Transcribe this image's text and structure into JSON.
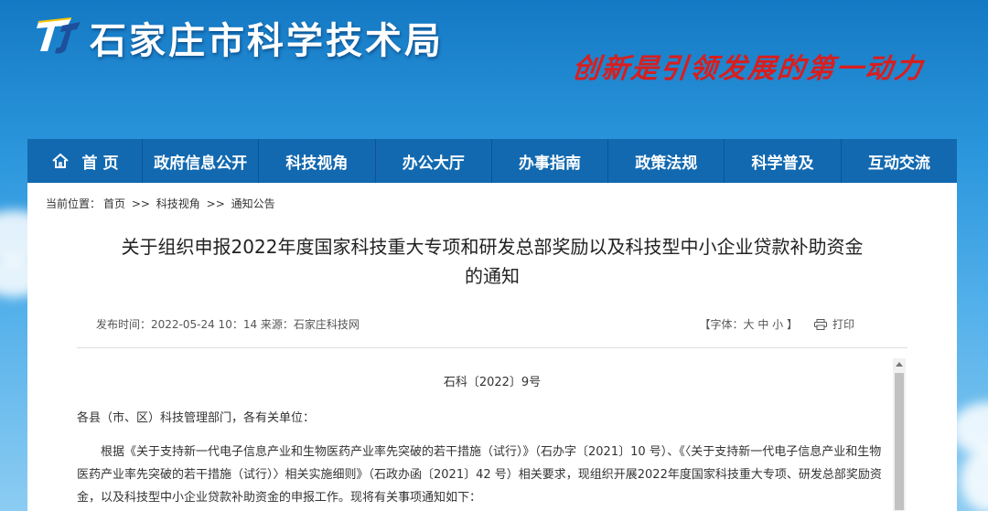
{
  "site": {
    "title": "石家庄市科学技术局",
    "slogan": "创新是引领发展的第一动力"
  },
  "nav": {
    "items": [
      {
        "label": "首 页"
      },
      {
        "label": "政府信息公开"
      },
      {
        "label": "科技视角"
      },
      {
        "label": "办公大厅"
      },
      {
        "label": "办事指南"
      },
      {
        "label": "政策法规"
      },
      {
        "label": "科学普及"
      },
      {
        "label": "互动交流"
      }
    ]
  },
  "breadcrumb": {
    "prefix": "当前位置：",
    "items": [
      "首页",
      "科技视角",
      "通知公告"
    ],
    "separator": ">>"
  },
  "article": {
    "title_line1": "关于组织申报2022年度国家科技重大专项和研发总部奖励以及科技型中小企业贷款补助资金",
    "title_line2": "的通知",
    "meta": "发布时间：2022-05-24 10：14  来源：石家庄科技网",
    "font_size_label": "【字体：大 中 小 】",
    "print_label": "打印",
    "doc_no": "石科〔2022〕9号",
    "salutation": "各县（市、区）科技管理部门，各有关单位：",
    "paragraph": "根据《关于支持新一代电子信息产业和生物医药产业率先突破的若干措施（试行）》（石办字〔2021〕10 号）、《〈关于支持新一代电子信息产业和生物医药产业率先突破的若干措施（试行）〉相关实施细则》（石政办函〔2021〕42 号）相关要求，现组织开展2022年度国家科技重大专项、研发总部奖励资金，以及科技型中小企业贷款补助资金的申报工作。现将有关事项通知如下："
  },
  "colors": {
    "nav_bg": "#1269b0",
    "slogan": "#d81e1e",
    "sky": "#2b96dc"
  }
}
